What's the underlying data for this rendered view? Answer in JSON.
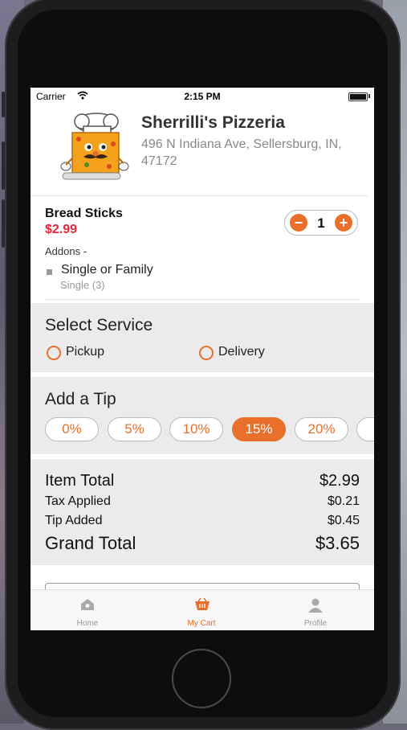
{
  "status_bar": {
    "carrier": "Carrier",
    "time": "2:15 PM"
  },
  "restaurant": {
    "name": "Sherrilli's Pizzeria",
    "address": "496 N Indiana Ave, Sellersburg, IN, 47172"
  },
  "cart_item": {
    "name": "Bread Sticks",
    "price": "$2.99",
    "addons_label": "Addons -",
    "addon_name": "Single or Family",
    "addon_detail": "Single (3)",
    "quantity": "1",
    "minus_symbol": "−",
    "plus_symbol": "+"
  },
  "service": {
    "title": "Select Service",
    "options": [
      {
        "label": "Pickup",
        "selected": false
      },
      {
        "label": "Delivery",
        "selected": false
      }
    ]
  },
  "tip": {
    "title": "Add a Tip",
    "options": [
      {
        "label": "0%",
        "selected": false
      },
      {
        "label": "5%",
        "selected": false
      },
      {
        "label": "10%",
        "selected": false
      },
      {
        "label": "15%",
        "selected": true
      },
      {
        "label": "20%",
        "selected": false
      }
    ]
  },
  "totals": {
    "item_total_label": "Item Total",
    "item_total": "$2.99",
    "tax_label": "Tax Applied",
    "tax": "$0.21",
    "tip_label": "Tip Added",
    "tip": "$0.45",
    "grand_total_label": "Grand Total",
    "grand_total": "$3.65"
  },
  "tabbar": {
    "items": [
      {
        "label": "Home",
        "icon": "home-icon",
        "active": false
      },
      {
        "label": "My Cart",
        "icon": "cart-icon",
        "active": true
      },
      {
        "label": "Profile",
        "icon": "profile-icon",
        "active": false
      }
    ]
  },
  "colors": {
    "accent": "#e8702a",
    "price": "#e8273a",
    "section_bg": "#ebebeb",
    "inactive_tab": "#999999"
  }
}
